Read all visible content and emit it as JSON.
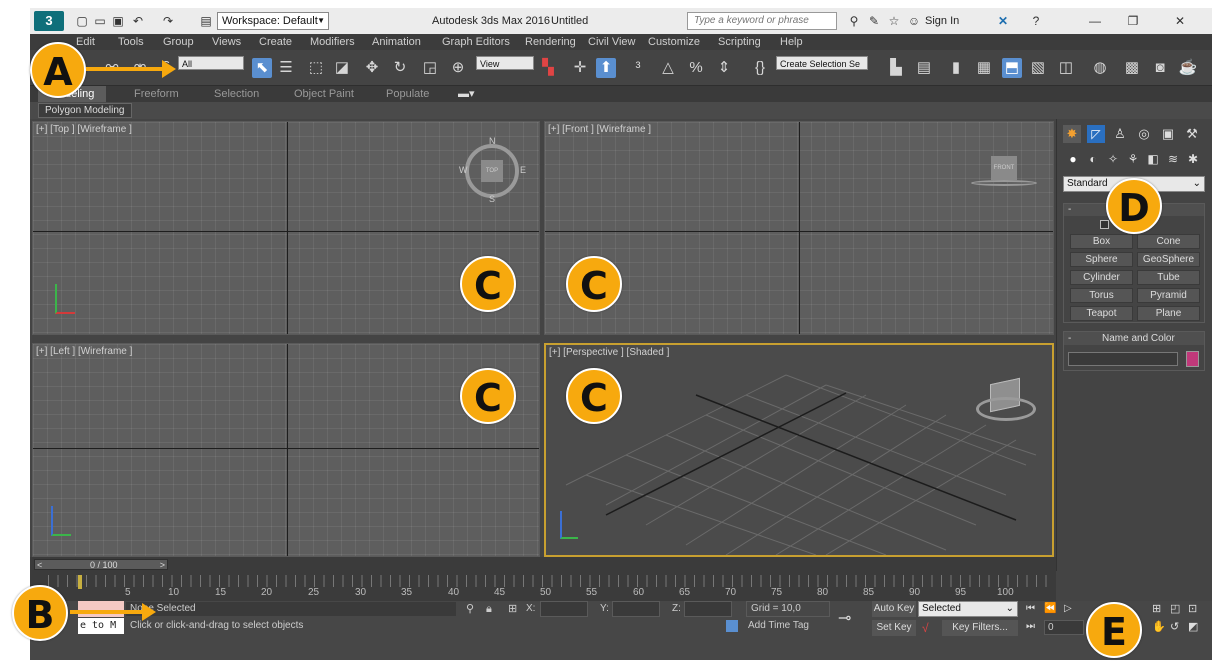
{
  "titlebar": {
    "workspace": "Workspace: Default",
    "app_title": "Autodesk 3ds Max 2016",
    "doc_title": "Untitled",
    "search_placeholder": "Type a keyword or phrase",
    "sign_in": "Sign In"
  },
  "menus": [
    "Edit",
    "Tools",
    "Group",
    "Views",
    "Create",
    "Modifiers",
    "Animation",
    "Graph Editors",
    "Rendering",
    "Civil View",
    "Customize",
    "Scripting",
    "Help"
  ],
  "toolbar": {
    "filter_select": "All",
    "view_select": "View",
    "selection_set": "Create Selection Se"
  },
  "ribbon": {
    "tabs": [
      "Modeling",
      "Freeform",
      "Selection",
      "Object Paint",
      "Populate"
    ],
    "active_panel": "Polygon Modeling"
  },
  "viewports": {
    "top": "[+] [Top ] [Wireframe ]",
    "front": "[+] [Front ] [Wireframe ]",
    "left": "[+] [Left ] [Wireframe ]",
    "perspective": "[+] [Perspective ] [Shaded ]",
    "compass": {
      "n": "N",
      "s": "S",
      "w": "W",
      "e": "E"
    },
    "viewcube_top": "TOP",
    "viewcube_front": "FRONT"
  },
  "command_panel": {
    "category": "Standard",
    "object_type_buttons": [
      "Box",
      "Cone",
      "Sphere",
      "GeoSphere",
      "Cylinder",
      "Tube",
      "Torus",
      "Pyramid",
      "Teapot",
      "Plane"
    ],
    "name_and_color": "Name and Color",
    "swatch_color": "#c0397a"
  },
  "timeline": {
    "frame_counter": "0 / 100",
    "ticks": [
      "5",
      "10",
      "15",
      "20",
      "25",
      "30",
      "35",
      "40",
      "45",
      "50",
      "55",
      "60",
      "65",
      "70",
      "75",
      "80",
      "85",
      "90",
      "95",
      "100"
    ]
  },
  "status": {
    "selection": "None Selected",
    "prompt": "Click or click-and-drag to select objects",
    "script_listener": "e to M",
    "x_label": "X:",
    "y_label": "Y:",
    "z_label": "Z:",
    "grid": "Grid = 10,0",
    "add_time_tag": "Add Time Tag",
    "auto_key": "Auto Key",
    "set_key": "Set Key",
    "key_mode": "Selected",
    "key_filters": "Key Filters...",
    "current_frame": "0"
  },
  "callouts": {
    "a": "A",
    "b": "B",
    "c": "C",
    "d": "D",
    "e": "E"
  },
  "colors": {
    "callout": "#f7a90e",
    "accent_blue": "#5a8fd0",
    "viewport_active_border": "#c8a030"
  }
}
